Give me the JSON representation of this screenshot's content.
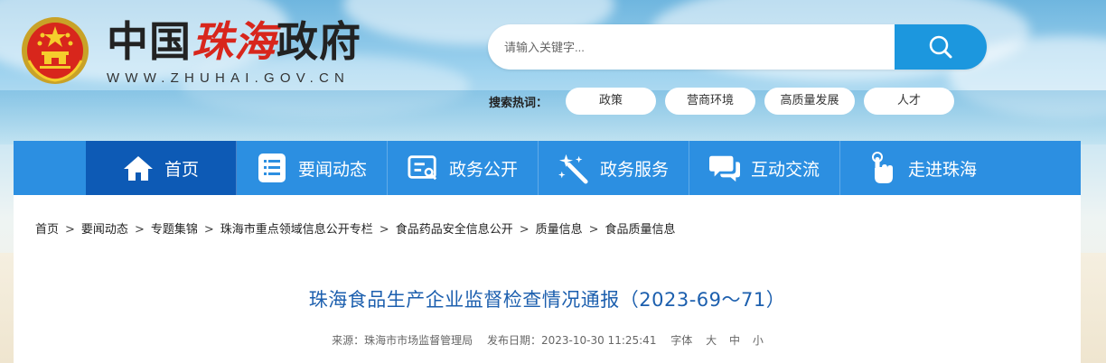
{
  "header": {
    "logo_prefix": "中国",
    "logo_city": "珠海",
    "logo_suffix": "政府",
    "logo_url": "WWW.ZHUHAI.GOV.CN"
  },
  "search": {
    "placeholder": "请输入关键字...",
    "icon": "search-icon"
  },
  "hot_search": {
    "label": "搜索热词：",
    "tags": [
      "政策",
      "营商环境",
      "高质量发展",
      "人才"
    ]
  },
  "nav": {
    "items": [
      {
        "label": "首页",
        "icon": "home-icon"
      },
      {
        "label": "要闻动态",
        "icon": "news-list-icon"
      },
      {
        "label": "政务公开",
        "icon": "disclosure-icon"
      },
      {
        "label": "政务服务",
        "icon": "service-wand-icon"
      },
      {
        "label": "互动交流",
        "icon": "chat-icon"
      },
      {
        "label": "走进珠海",
        "icon": "hand-pointer-icon"
      }
    ],
    "active_color": "#0d5ab5",
    "bar_color": "#2c8fe1"
  },
  "breadcrumb": [
    "首页",
    "要闻动态",
    "专题集锦",
    "珠海市重点领域信息公开专栏",
    "食品药品安全信息公开",
    "质量信息",
    "食品质量信息"
  ],
  "article": {
    "title": "珠海食品生产企业监督检查情况通报（2023-69～71）",
    "source": "来源：珠海市市场监督管理局",
    "date": "发布日期：2023-10-30 11:25:41",
    "font_label": "字体",
    "font_large": "大",
    "font_medium": "中",
    "font_small": "小"
  }
}
